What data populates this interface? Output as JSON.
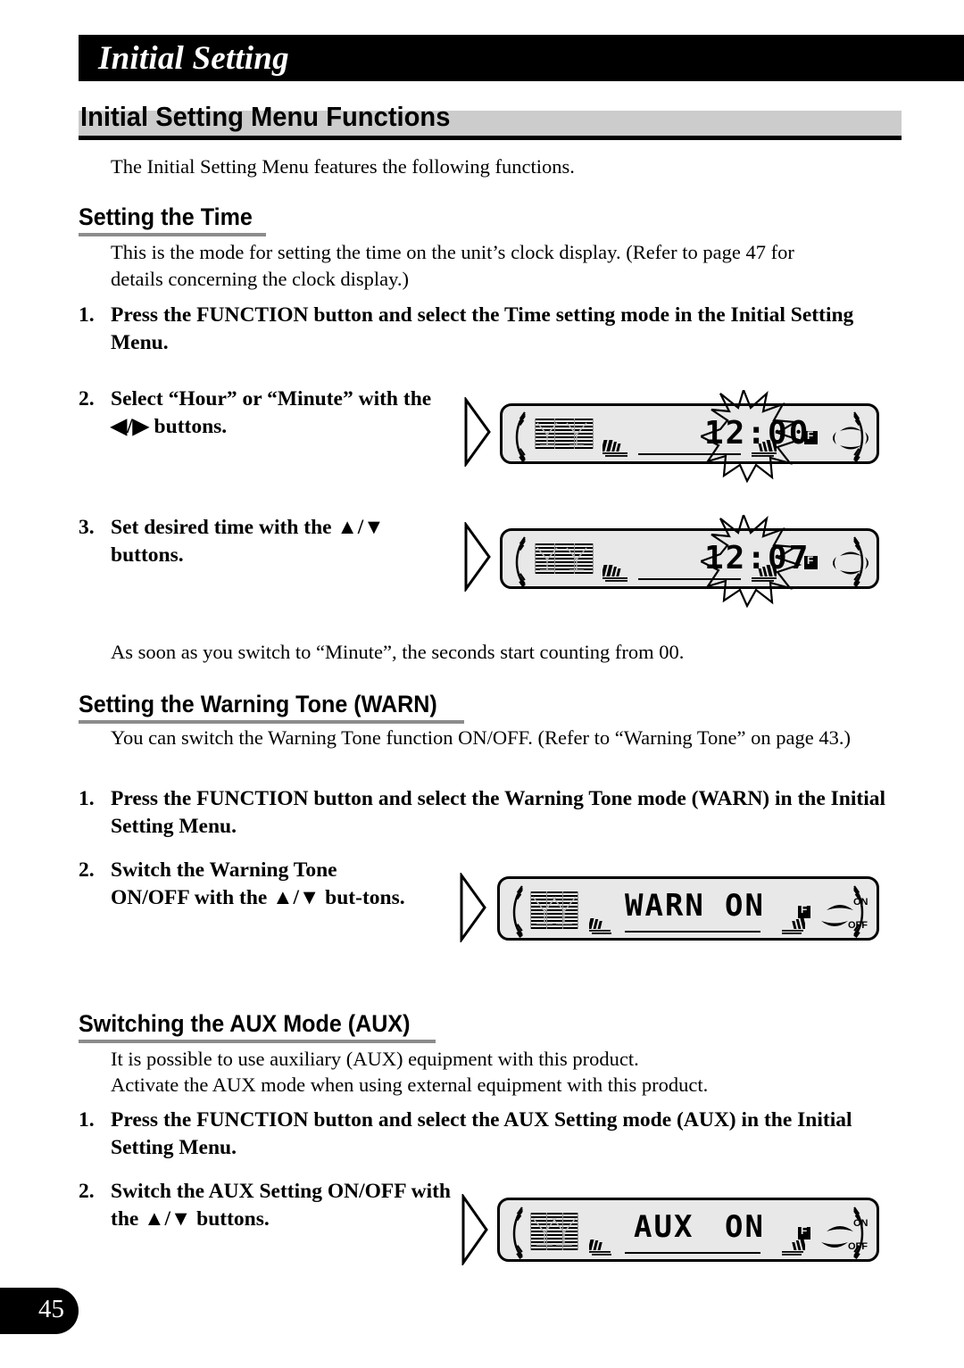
{
  "chapter": {
    "title": "Initial Setting"
  },
  "section": {
    "heading": "Initial Setting Menu Functions",
    "intro": "The Initial Setting Menu features the following functions."
  },
  "subsections": [
    {
      "heading": "Setting the Time",
      "body": "This is the mode for setting the time on the unit’s clock display. (Refer to page 47 for details concerning the clock display.)",
      "steps": [
        {
          "num": "1.",
          "text": "Press the FUNCTION button and select the Time setting mode in the Initial Setting Menu."
        },
        {
          "num": "2.",
          "text": "Select “Hour” or “Minute” with the ◀/▶ buttons."
        },
        {
          "num": "3.",
          "text": "Set desired time with the ▲/▼ buttons."
        }
      ],
      "note": "As soon as you switch to “Minute”, the seconds start counting from 00."
    },
    {
      "heading": "Setting the Warning Tone (WARN)",
      "body": "You can switch the Warning Tone function ON/OFF. (Refer to “Warning Tone” on page 43.)",
      "steps": [
        {
          "num": "1.",
          "text": "Press the FUNCTION button and select the Warning Tone mode (WARN) in the Initial Setting Menu."
        },
        {
          "num": "2.",
          "text": "Switch the Warning Tone ON/OFF with the ▲/▼ but-tons."
        }
      ]
    },
    {
      "heading": "Switching the AUX Mode (AUX)",
      "body_lines": [
        "It is possible to use auxiliary (AUX) equipment with this product.",
        "Activate the AUX mode when using external equipment with this product."
      ],
      "steps": [
        {
          "num": "1.",
          "text": "Press the FUNCTION button and select the AUX Setting mode (AUX) in the Initial Setting Menu."
        },
        {
          "num": "2.",
          "text": "Switch the AUX Setting ON/OFF with the ▲/▼ buttons."
        }
      ]
    }
  ],
  "displays": [
    {
      "id": "clock-1200",
      "main_text": "12:00",
      "blinking_part": "00",
      "indicator_f": "F",
      "right_icon": "four-way-pad",
      "flash": true
    },
    {
      "id": "clock-1207",
      "main_text": "12:07",
      "blinking_part": "07",
      "indicator_f": "F",
      "right_icon": "four-way-pad",
      "flash": true
    },
    {
      "id": "warn-on",
      "label_text": "WARN",
      "value_text": "ON",
      "indicator_f": "F",
      "on_label": "ON",
      "off_label": "OFF",
      "flash": false
    },
    {
      "id": "aux-on",
      "label_text": "AUX",
      "value_text": "ON",
      "indicator_f": "F",
      "on_label": "ON",
      "off_label": "OFF",
      "flash": false
    }
  ],
  "footer": {
    "page_number": "45"
  },
  "colors": {
    "band_black": "#000000",
    "band_gray": "#cccccc",
    "rule_gray": "#8c8c8c",
    "lcd_bg": "#e8e8e8"
  }
}
